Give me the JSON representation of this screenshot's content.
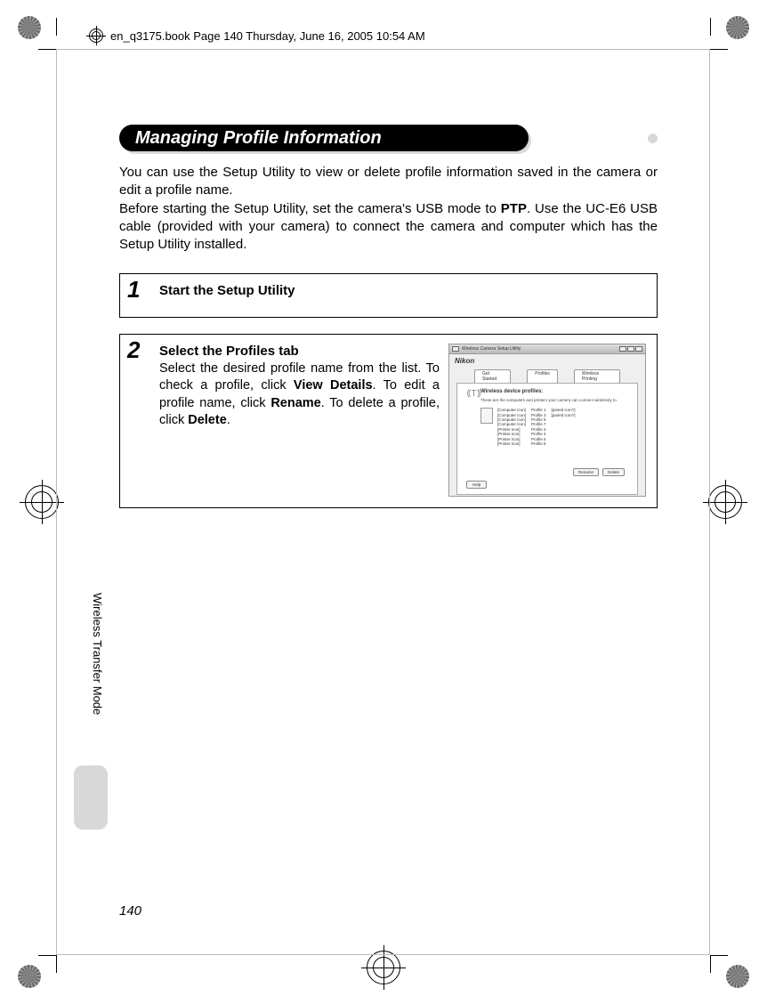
{
  "header": {
    "file_info": "en_q3175.book  Page 140  Thursday, June 16, 2005  10:54 AM"
  },
  "section": {
    "title": "Managing Profile Information"
  },
  "intro": {
    "p1a": "You can use the Setup Utility to view or delete profile information saved in the camera or edit a profile name.",
    "p2a": "Before starting the Setup Utility, set the camera's USB mode to ",
    "p2b": "PTP",
    "p2c": ". Use the UC-E6 USB cable (provided with your camera) to connect the camera and computer which has the Setup Utility installed."
  },
  "steps": [
    {
      "num": "1",
      "title": "Start the Setup Utility",
      "body_parts": []
    },
    {
      "num": "2",
      "title": "Select the Profiles tab",
      "body_parts": [
        {
          "t": "text",
          "v": "Select the desired profile name from the list. To check a profile, click "
        },
        {
          "t": "bold",
          "v": "View Details"
        },
        {
          "t": "text",
          "v": ". To edit a profile name, click "
        },
        {
          "t": "bold",
          "v": "Rename"
        },
        {
          "t": "text",
          "v": ". To delete a profile, click "
        },
        {
          "t": "bold",
          "v": "Delete"
        },
        {
          "t": "text",
          "v": "."
        }
      ]
    }
  ],
  "inset": {
    "window_title": "Wireless Camera Setup Utility",
    "brand": "Nikon",
    "tabs": [
      "Get Started",
      "Profiles",
      "Wireless Printing"
    ],
    "panel_title": "Wireless device profiles:",
    "panel_sub": "These are the computers and printers your camera can connect wirelessly to.",
    "col_icons": [
      "[Computer Icon]",
      "[Computer Icon]",
      "[Computer Icon]",
      "[Computer Icon]",
      "[Printer Icon]",
      "[Printer Icon]",
      "[Printer Icon]",
      "[Printer Icon]"
    ],
    "col_names": [
      "Profile 1",
      "Profile 3",
      "Profile 5",
      "Profile 7",
      "Profile 2",
      "Profile 4",
      "Profile 6",
      "Profile 8"
    ],
    "col_status": [
      "[paired icon?]",
      "",
      "",
      "",
      "",
      "[paired icon?]",
      "",
      ""
    ],
    "btn_rename": "Rename",
    "btn_delete": "Delete",
    "btn_help": "Help"
  },
  "side_label": "Wireless Transfer Mode",
  "page_number": "140"
}
